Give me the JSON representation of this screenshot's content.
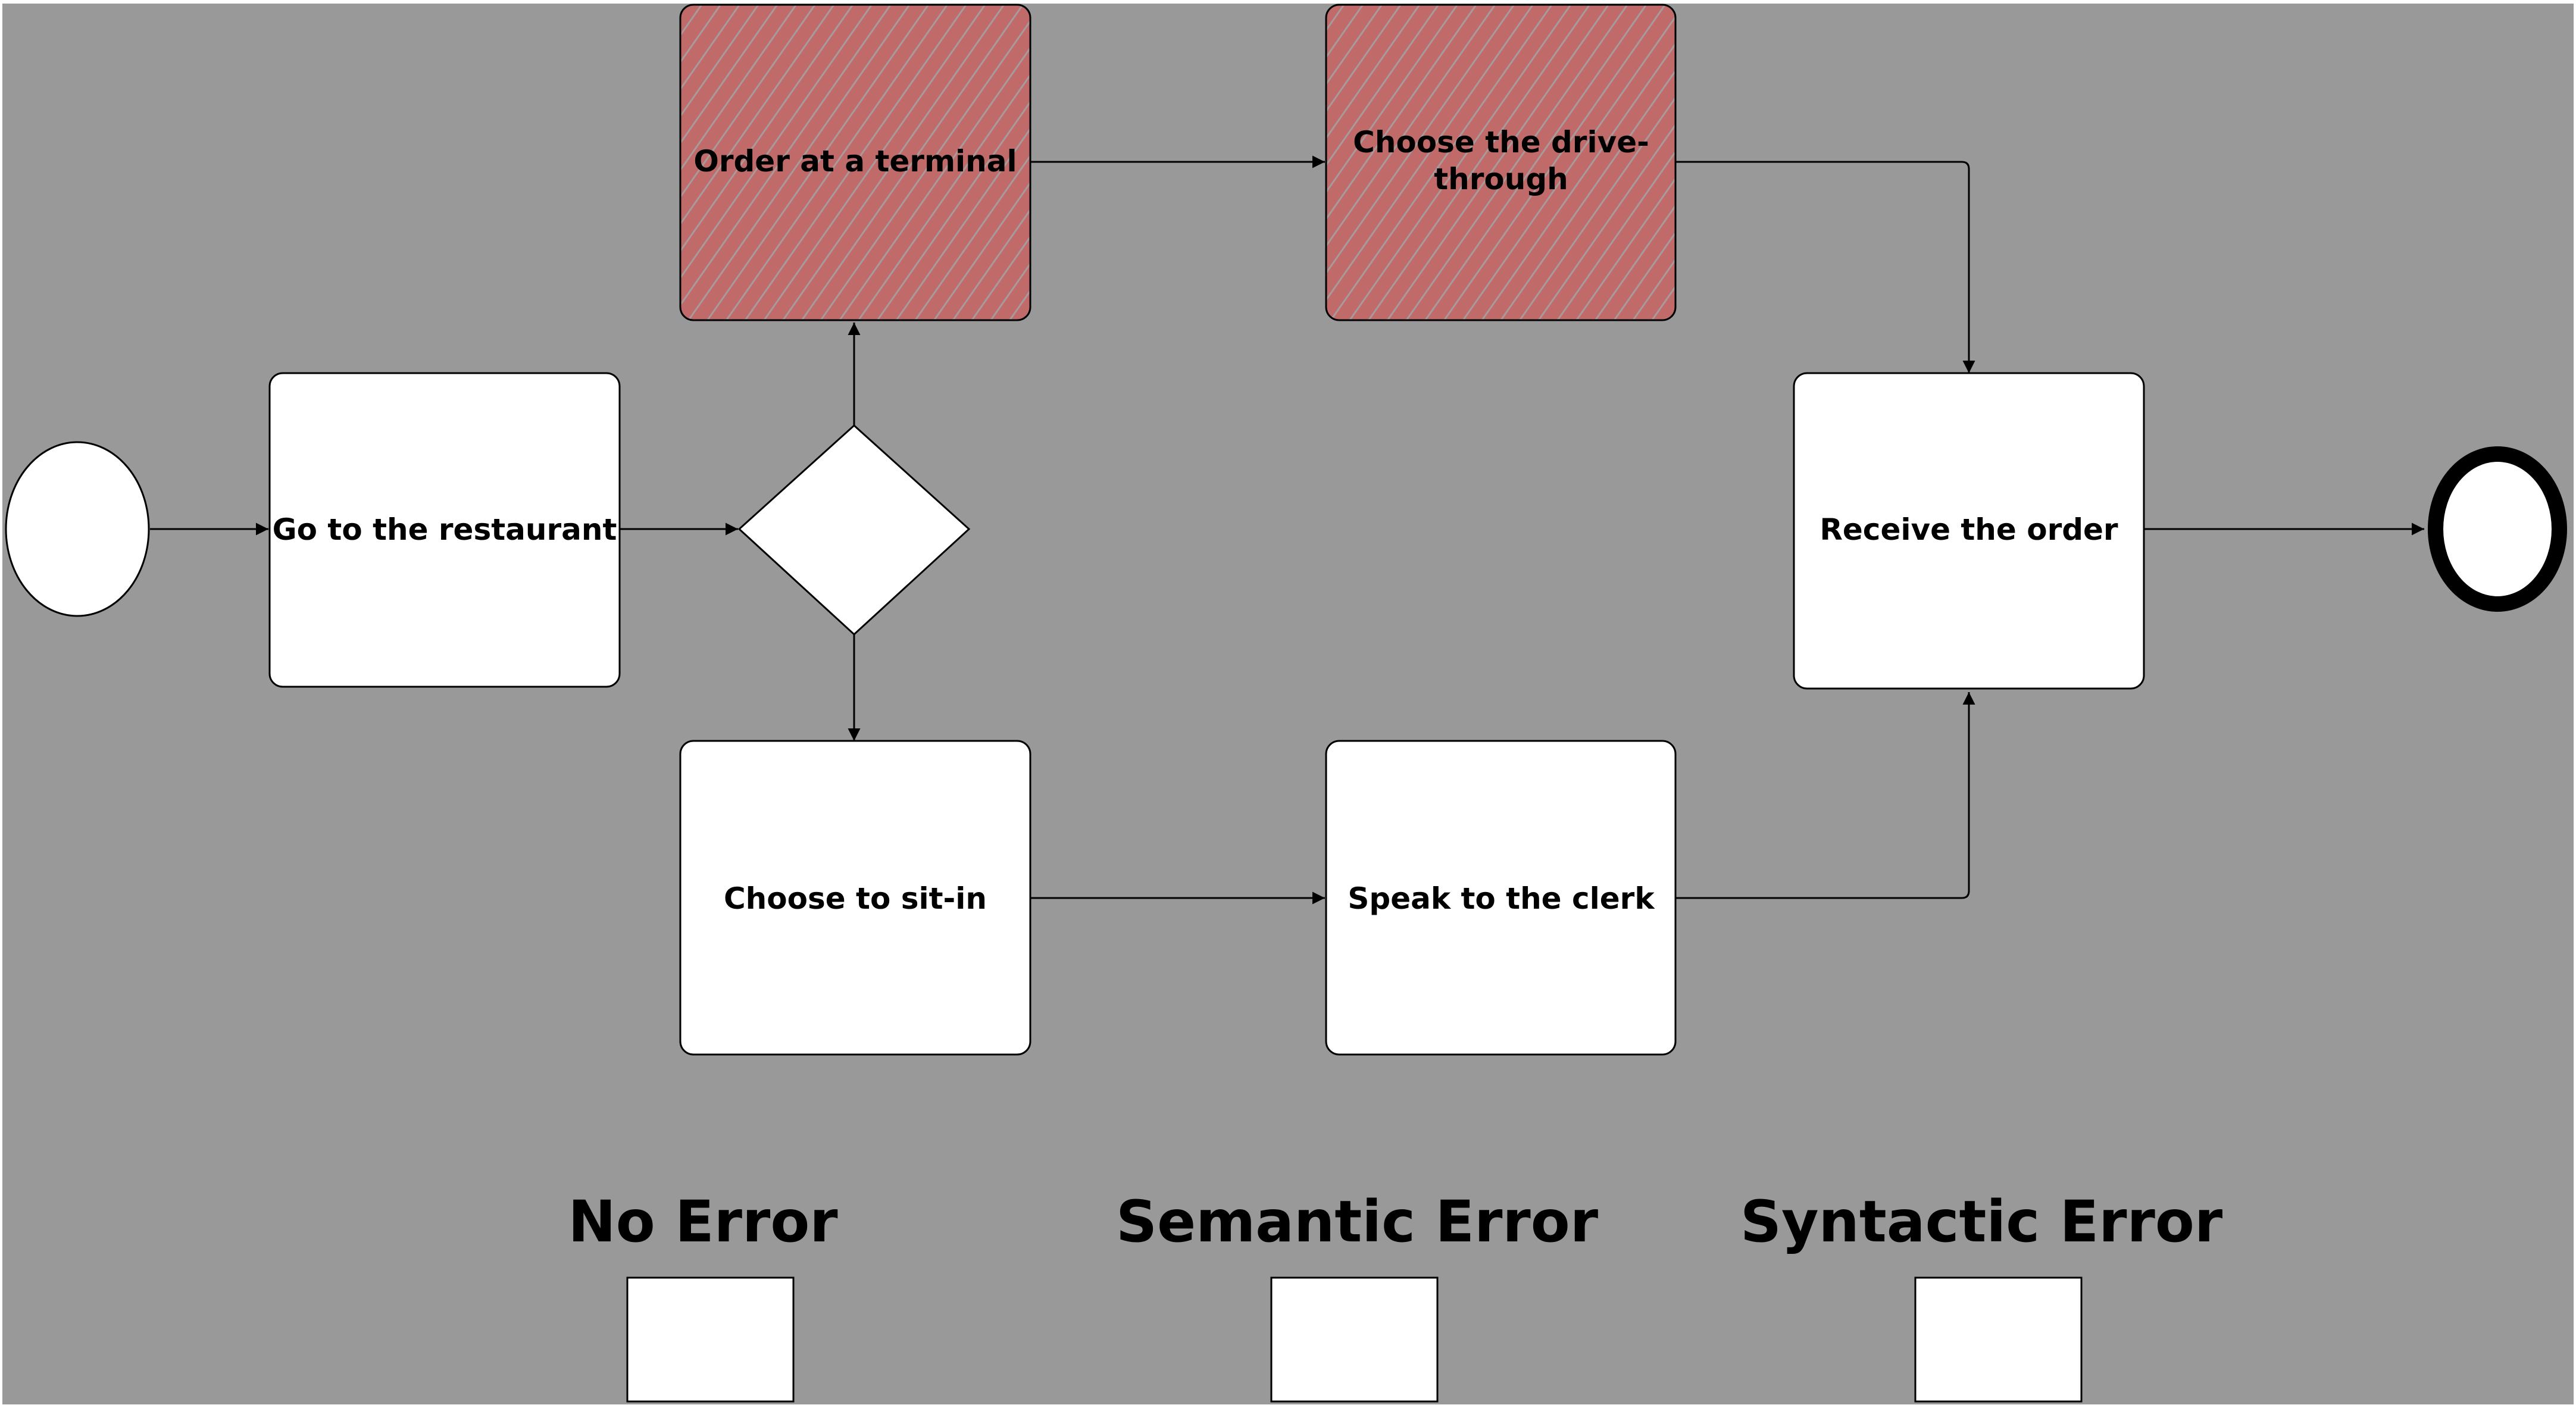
{
  "diagram": {
    "type": "BPMN process",
    "colors": {
      "background": "#999999",
      "task_fill": "#ffffff",
      "error_fill": "#c06a6a",
      "error_hatch": "#a89a9a",
      "stroke": "#000000"
    },
    "start_event": {
      "label": ""
    },
    "end_event": {
      "label": ""
    },
    "gateway": {
      "label": ""
    },
    "tasks": {
      "go_to_restaurant": {
        "label": "Go to the restaurant",
        "highlighted": false
      },
      "order_terminal": {
        "label": "Order at a terminal",
        "highlighted": true
      },
      "drive_through": {
        "label_line1": "Choose the drive-",
        "label_line2": "through",
        "highlighted": true
      },
      "sit_in": {
        "label": "Choose to sit-in",
        "highlighted": false
      },
      "speak_clerk": {
        "label": "Speak to the clerk",
        "highlighted": false
      },
      "receive_order": {
        "label": "Receive the order",
        "highlighted": false
      }
    },
    "flows": [
      {
        "from": "start",
        "to": "Go to the restaurant"
      },
      {
        "from": "Go to the restaurant",
        "to": "gateway"
      },
      {
        "from": "gateway",
        "to": "Order at a terminal"
      },
      {
        "from": "gateway",
        "to": "Choose to sit-in"
      },
      {
        "from": "Order at a terminal",
        "to": "Choose the drive-through"
      },
      {
        "from": "Choose the drive-through",
        "to": "Receive the order"
      },
      {
        "from": "Choose to sit-in",
        "to": "Speak to the clerk"
      },
      {
        "from": "Speak to the clerk",
        "to": "Receive the order"
      },
      {
        "from": "Receive the order",
        "to": "end"
      }
    ]
  },
  "answer_options": [
    {
      "label": "No Error",
      "checked": false
    },
    {
      "label": "Semantic Error",
      "checked": false
    },
    {
      "label": "Syntactic Error",
      "checked": false
    }
  ]
}
